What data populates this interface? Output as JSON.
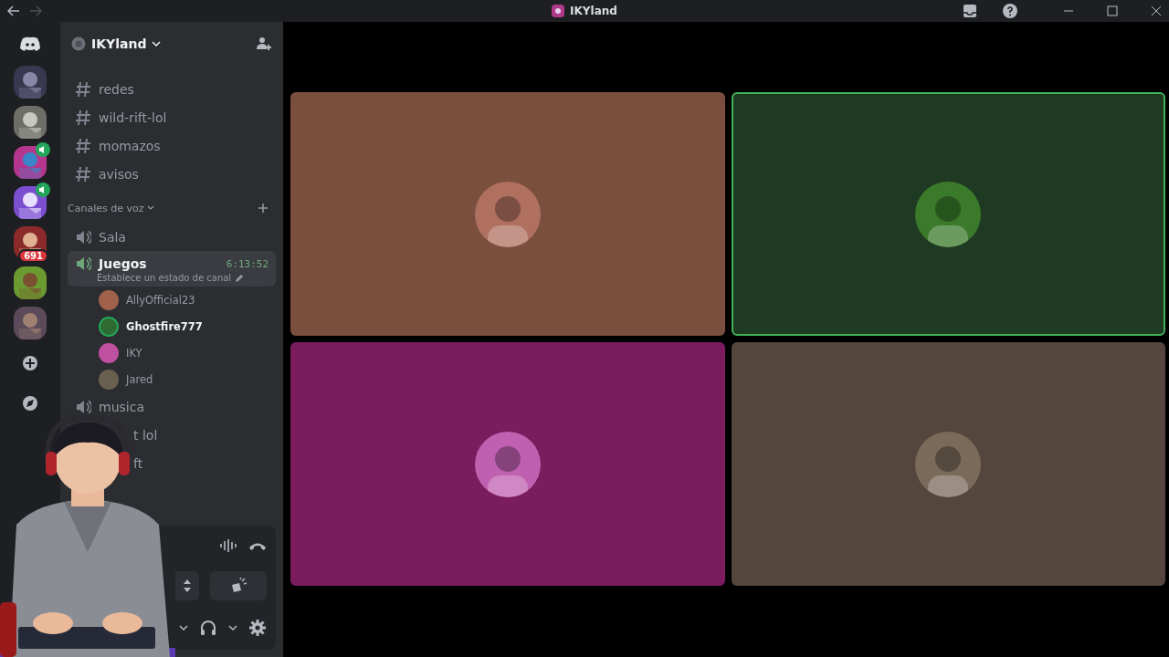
{
  "window": {
    "title": "IKYland"
  },
  "servers": [
    {
      "kind": "picture",
      "voice": false
    },
    {
      "kind": "picture",
      "voice": false
    },
    {
      "kind": "picture",
      "voice": true
    },
    {
      "kind": "picture",
      "voice": true
    },
    {
      "kind": "picture",
      "voice": false,
      "badge": "691"
    },
    {
      "kind": "picture",
      "voice": false
    },
    {
      "kind": "picture",
      "voice": false
    }
  ],
  "sidebar": {
    "server_name": "IKYland",
    "text_channels": [
      "redes",
      "wild-rift-lol",
      "momazos",
      "avisos"
    ],
    "voice_category": "Canales de voz",
    "voice_channels": [
      {
        "name": "Sala",
        "selected": false
      },
      {
        "name": "Juegos",
        "selected": true,
        "timer": "6:13:52",
        "status": "Establece un estado de canal",
        "members": [
          {
            "name": "AllyOfficial23",
            "speaking": false,
            "color": "#a0624a"
          },
          {
            "name": "Ghostfire777",
            "speaking": true,
            "color": "#2e6a32"
          },
          {
            "name": "IKY",
            "speaking": false,
            "color": "#c050a0"
          },
          {
            "name": "Jared",
            "speaking": false,
            "color": "#6a6050"
          }
        ]
      },
      {
        "name": "musica",
        "selected": false
      },
      {
        "name": "t lol",
        "selected": false,
        "covered": true
      },
      {
        "name": "ft",
        "selected": false,
        "covered": true
      }
    ]
  },
  "tiles": [
    {
      "color": "#7a4f3e",
      "speaking": false,
      "kind": "picture"
    },
    {
      "color": "#1f3a22",
      "speaking": true,
      "kind": "picture"
    },
    {
      "color": "#7a1c5e",
      "speaking": false,
      "kind": "picture"
    },
    {
      "color": "#54463c",
      "speaking": false,
      "kind": "picture"
    }
  ]
}
